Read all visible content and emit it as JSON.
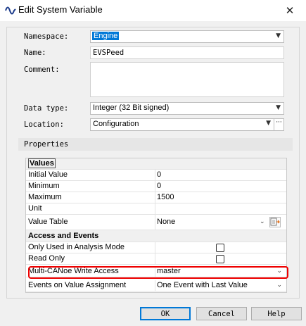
{
  "window": {
    "title": "Edit System Variable"
  },
  "form": {
    "namespace_label": "Namespace:",
    "namespace_value": "Engine",
    "name_label": "Name:",
    "name_value": "EVSPeed",
    "comment_label": "Comment:",
    "comment_value": "",
    "datatype_label": "Data type:",
    "datatype_value": "Integer (32 Bit signed)",
    "location_label": "Location:",
    "location_value": "Configuration",
    "location_more": "···"
  },
  "properties": {
    "title": "Properties",
    "values_header": "Values",
    "rows": [
      {
        "name": "Initial Value",
        "value": "0"
      },
      {
        "name": "Minimum",
        "value": "0"
      },
      {
        "name": "Maximum",
        "value": "1500"
      },
      {
        "name": "Unit",
        "value": ""
      },
      {
        "name": "Value Table",
        "value": "None"
      }
    ],
    "access_header": "Access and Events",
    "access_rows": [
      {
        "name": "Only Used in Analysis Mode",
        "checked": false
      },
      {
        "name": "Read Only",
        "checked": false
      },
      {
        "name": "Multi-CANoe Write Access",
        "value": "master"
      },
      {
        "name": "Events on Value Assignment",
        "value": "One Event with Last Value"
      }
    ]
  },
  "buttons": {
    "ok": "OK",
    "cancel": "Cancel",
    "help": "Help"
  },
  "icons": {
    "app": "wave-icon",
    "close": "close-icon",
    "dropdown": "chevron-down-icon",
    "value_table_edit": "table-edit-icon"
  },
  "colors": {
    "highlight": "#e00000",
    "selection": "#0078d7",
    "default_button_border": "#0078d7"
  }
}
